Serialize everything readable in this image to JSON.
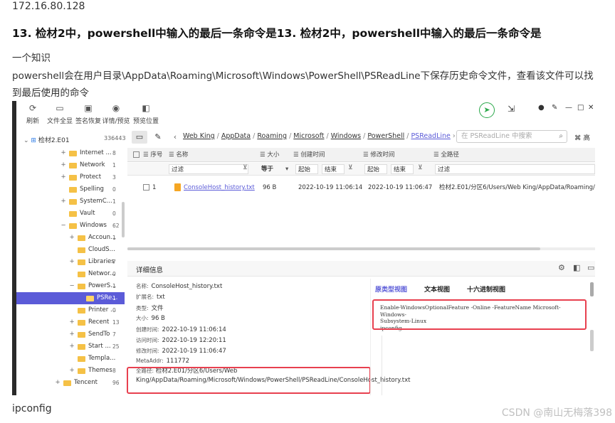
{
  "article": {
    "ip": "172.16.80.128",
    "question": "13. 检材2中，powershell中输入的最后一条命令是13. 检材2中，powershell中输入的最后一条命令是",
    "p1": "一个知识",
    "p2": "powershell会在用户目录\\AppData\\Roaming\\Microsoft\\Windows\\PowerShell\\PSReadLine下保存历史命令文件，查看该文件可以找到最后使用的命令",
    "answer": "ipconfig",
    "watermark": "CSDN @南山无梅落398"
  },
  "toolbar": {
    "refresh": "刷新",
    "all_files": "文件全显",
    "sign_restore": "签名恢复",
    "detail_preview": "详情/预览",
    "preview_pos": "预览位置"
  },
  "sidebar": {
    "root_label": "检材2.E01",
    "root_count": "336443",
    "items": [
      {
        "label": "Internet ...",
        "count": "8"
      },
      {
        "label": "Network",
        "count": "1"
      },
      {
        "label": "Protect",
        "count": "3"
      },
      {
        "label": "Spelling",
        "count": "0"
      },
      {
        "label": "SystemC...",
        "count": "1"
      },
      {
        "label": "Vault",
        "count": "0"
      },
      {
        "label": "Windows",
        "count": "62"
      },
      {
        "label": "Accoun...",
        "count": "1"
      },
      {
        "label": "CloudS...",
        "count": ""
      },
      {
        "label": "Libraries",
        "count": "7"
      },
      {
        "label": "Networ...",
        "count": "0"
      },
      {
        "label": "PowerS...",
        "count": "1"
      },
      {
        "label": "PSRe...",
        "count": "1"
      },
      {
        "label": "Printer ...",
        "count": "0"
      },
      {
        "label": "Recent",
        "count": "13"
      },
      {
        "label": "SendTo",
        "count": "7"
      },
      {
        "label": "Start ...",
        "count": "25"
      },
      {
        "label": "Templa...",
        "count": ""
      },
      {
        "label": "Themes",
        "count": "8"
      },
      {
        "label": "Tencent",
        "count": "96"
      }
    ]
  },
  "nav": {
    "crumbs": [
      "Web King",
      "AppData",
      "Roaming",
      "Microsoft",
      "Windows",
      "PowerShell",
      "PSReadLine"
    ],
    "search_placeholder": "在 PSReadLine 中搜索",
    "right_label": "高"
  },
  "table": {
    "headers": {
      "index": "序号",
      "name": "名称",
      "size": "大小",
      "created": "创建时间",
      "modified": "修改时间",
      "fullpath": "全路径"
    },
    "filters": {
      "name": "过滤",
      "size_op": "等于",
      "c_start": "起始",
      "c_end": "结束",
      "m_start": "起始",
      "m_end": "结束",
      "path": "过滤"
    },
    "rows": [
      {
        "index": "1",
        "name": "ConsoleHost_history.txt",
        "size": "96 B",
        "created": "2022-10-19 11:06:14",
        "modified": "2022-10-19 11:06:47",
        "path": "检材2.E01/分区6/Users/Web King/AppData/Roaming/Micr"
      }
    ]
  },
  "details": {
    "title": "详细信息",
    "name_k": "名称:",
    "name_v": "ConsoleHost_history.txt",
    "ext_k": "扩展名:",
    "ext_v": "txt",
    "type_k": "类型:",
    "type_v": "文件",
    "size_k": "大小:",
    "size_v": "96 B",
    "ctime_k": "创建时间:",
    "ctime_v": "2022-10-19 11:06:14",
    "atime_k": "访问时间:",
    "atime_v": "2022-10-19 12:20:11",
    "mtime_k": "修改时间:",
    "mtime_v": "2022-10-19 11:06:47",
    "meta_k": "MetaAddr:",
    "meta_v": "111772",
    "path_k": "全路径:",
    "path_v": "检材2.E01/分区6/Users/Web King/AppData/Roaming/Microsoft/Windows/PowerShell/PSReadLine/ConsoleHost_history.txt"
  },
  "preview": {
    "tab_raw": "原类型视图",
    "tab_text": "文本视图",
    "tab_hex": "十六进制视图",
    "line1": "Enable-WindowsOptionalFeature -Online -FeatureName Microsoft-Windows-",
    "line2": "Subsystem-Linux",
    "line3": "ipconfig"
  }
}
